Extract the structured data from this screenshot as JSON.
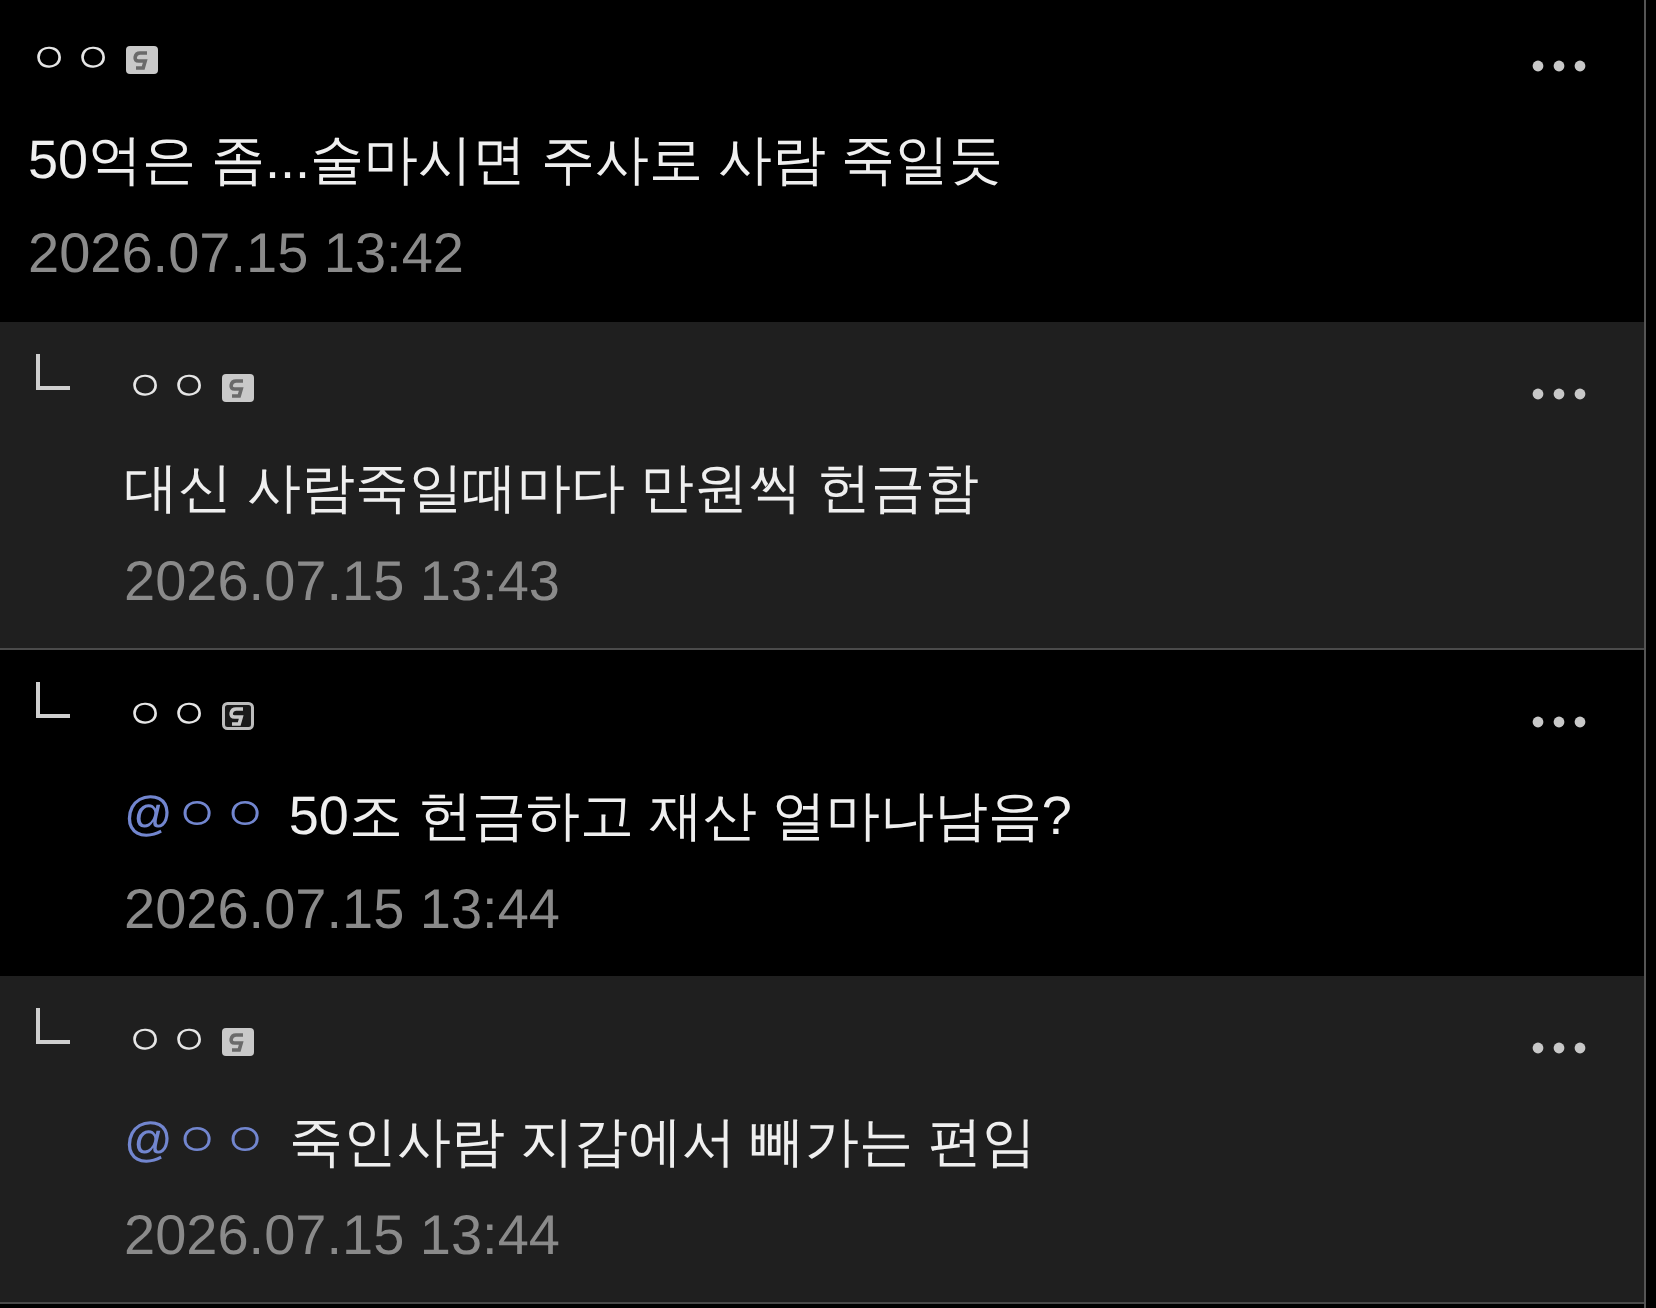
{
  "comments": [
    {
      "kind": "comment",
      "highlighted": false,
      "author": "ㅇㅇ",
      "badge": {
        "kind": "filled"
      },
      "text": "50억은 좀...술마시면 주사로 사람 죽일듯",
      "date": "2026.07.15 13:42"
    },
    {
      "kind": "reply",
      "highlighted": true,
      "author": "ㅇㅇ",
      "badge": {
        "kind": "filled"
      },
      "text": "대신 사람죽일때마다 만원씩 헌금함",
      "date": "2026.07.15 13:43"
    },
    {
      "kind": "reply",
      "highlighted": false,
      "author": "ㅇㅇ",
      "badge": {
        "kind": "outline"
      },
      "mention": "@ㅇㅇ",
      "text": "50조 헌금하고 재산 얼마나남음?",
      "date": "2026.07.15 13:44"
    },
    {
      "kind": "reply",
      "highlighted": true,
      "author": "ㅇㅇ",
      "badge": {
        "kind": "filled"
      },
      "mention": "@ㅇㅇ",
      "text": "죽인사람 지갑에서 빼가는 편임",
      "date": "2026.07.15 13:44"
    }
  ]
}
